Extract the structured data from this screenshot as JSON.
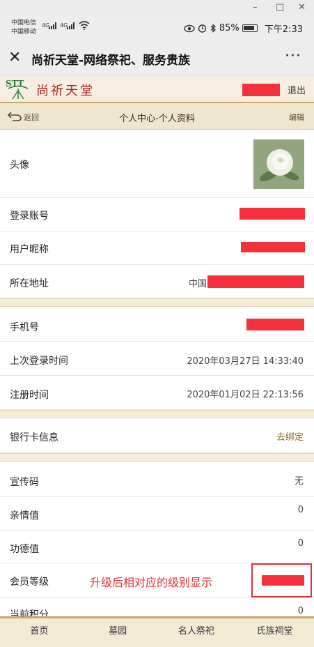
{
  "window_controls": {
    "minimize": "–",
    "maximize": "□",
    "close": "✕"
  },
  "status_bar": {
    "carrier1": "中国电信",
    "carrier2": "中国移动",
    "net1": "4G",
    "net2": "4G",
    "battery": "85%",
    "time": "下午2:33",
    "icons": [
      "eye-icon",
      "alarm-icon",
      "bluetooth-icon",
      "battery-icon"
    ]
  },
  "titlebar": {
    "close_icon": "✕",
    "title": "尚祈天堂-网络祭祀、服务贵族",
    "more_icon": "···"
  },
  "site_header": {
    "logo_abbr": "STT",
    "logo_text": "尚祈天堂",
    "logout": "退出"
  },
  "subheader": {
    "back": "返回",
    "title": "个人中心-个人资料",
    "edit": "编辑"
  },
  "profile": {
    "avatar_label": "头像",
    "account_label": "登录账号",
    "nickname_label": "用户昵称",
    "address_label": "所在地址",
    "address_prefix": "中国",
    "phone_label": "手机号",
    "last_login_label": "上次登录时间",
    "last_login_value": "2020年03月27日 14:33:40",
    "register_label": "注册时间",
    "register_value": "2020年01月02日 22:13:56",
    "bank_label": "银行卡信息",
    "bank_action": "去绑定",
    "promo_label": "宣传码",
    "promo_value": "无",
    "kinship_label": "亲情值",
    "kinship_value": "0",
    "merit_label": "功德值",
    "merit_value": "0",
    "member_label": "会员等级",
    "points_label": "当前积分",
    "points_value": "0"
  },
  "annotation": "升级后相对应的级别显示",
  "bottom_nav": [
    "首页",
    "墓园",
    "名人祭祀",
    "氏族祠堂"
  ],
  "colors": {
    "redaction": "#f4313b",
    "accent_gold": "#c9a765",
    "brand_red": "#b02020",
    "annotation_red": "#e63131"
  }
}
